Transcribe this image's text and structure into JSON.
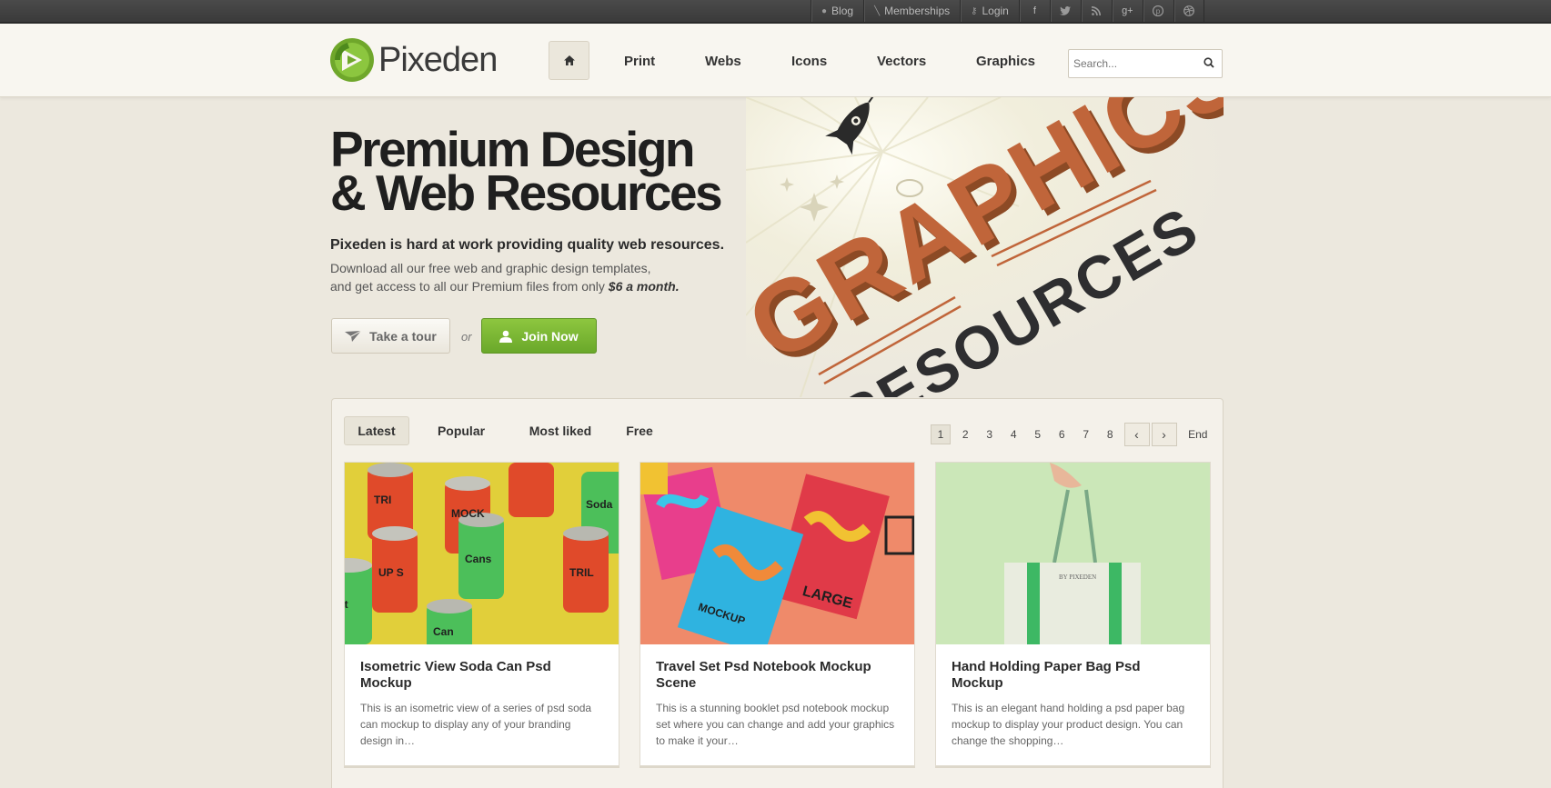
{
  "topbar": {
    "links": [
      {
        "label": "Blog",
        "icon": "speech-bubble-icon"
      },
      {
        "label": "Memberships",
        "icon": "pencil-icon"
      },
      {
        "label": "Login",
        "icon": "key-icon"
      }
    ],
    "social": [
      "f",
      "t",
      "rss",
      "g+",
      "p",
      "d"
    ]
  },
  "header": {
    "logo_text": "Pixeden",
    "nav": [
      "Print",
      "Webs",
      "Icons",
      "Vectors",
      "Graphics"
    ],
    "search_placeholder": "Search..."
  },
  "hero": {
    "title_line1": "Premium Design",
    "title_line2": "& Web Resources",
    "subtitle": "Pixeden is hard at work providing quality web resources.",
    "desc_line1": "Download all our free web and graphic design templates,",
    "desc_line2": "and get access to all our Premium files from only",
    "price": "$6 a month.",
    "tour_label": "Take a tour",
    "or_label": "or",
    "join_label": "Join Now",
    "art_word1": "GRAPHICS",
    "art_word2": "RESOURCES"
  },
  "panel": {
    "tabs": [
      "Latest",
      "Popular",
      "Most liked",
      "Free"
    ],
    "pages": [
      "1",
      "2",
      "3",
      "4",
      "5",
      "6",
      "7",
      "8"
    ],
    "prev": "‹",
    "next": "›",
    "end_label": "End",
    "cards": [
      {
        "title": "Isometric View Soda Can Psd Mockup",
        "desc": "This is an isometric view of a series of psd soda can mockup to display any of your branding design in…"
      },
      {
        "title": "Travel Set Psd Notebook Mockup Scene",
        "desc": "This is a stunning booklet psd notebook mockup set where you can change and add your graphics to make it your…"
      },
      {
        "title": "Hand Holding Paper Bag Psd Mockup",
        "desc": "This is an elegant hand holding a psd paper bag mockup to display your product design. You can change the shopping…"
      }
    ]
  },
  "colors": {
    "brand_green": "#7ab733",
    "join_green": "#7cb935",
    "background": "#ece8de"
  }
}
